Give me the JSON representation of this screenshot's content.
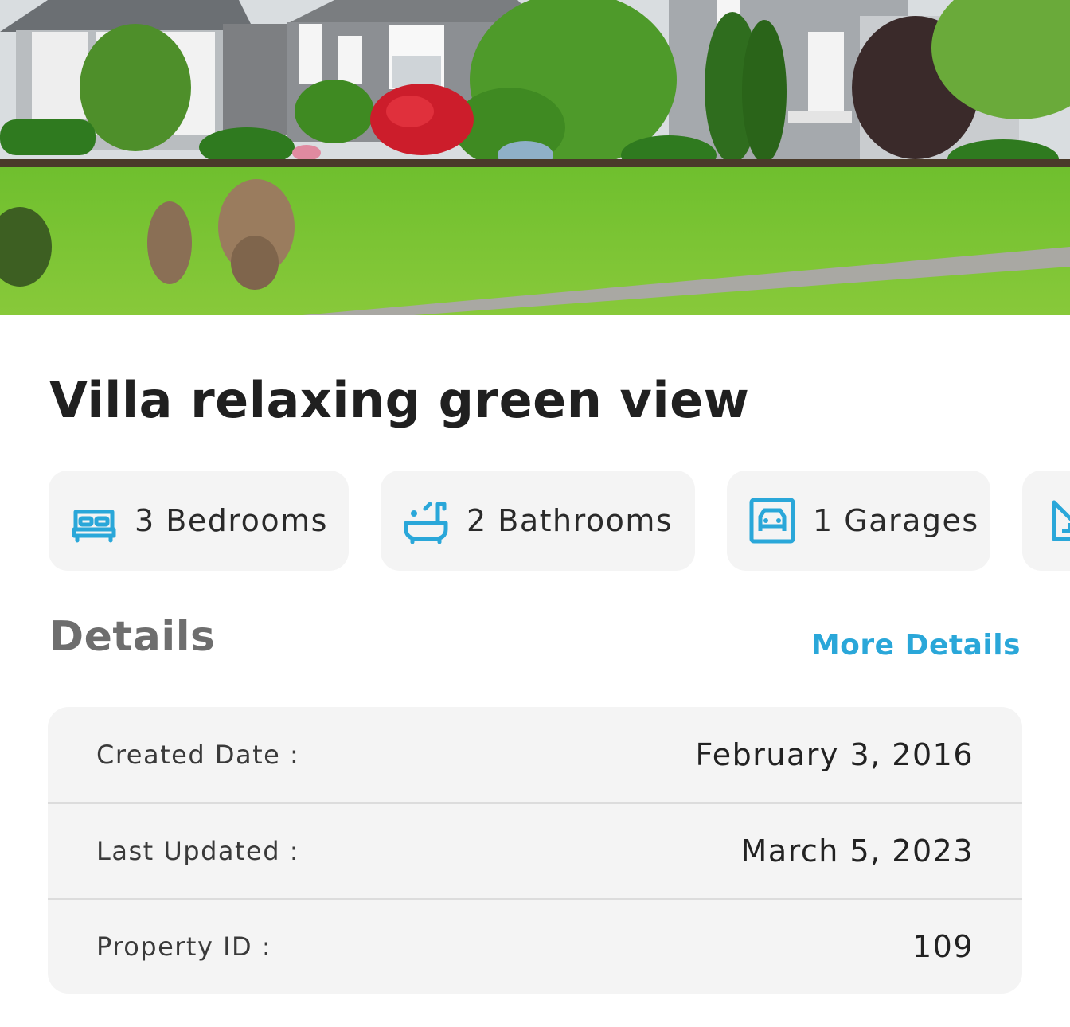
{
  "hero": {
    "image_description": "villa-front-yard-photo"
  },
  "title": "Villa relaxing green view",
  "features": [
    {
      "icon": "bed-icon",
      "label": "3 Bedrooms"
    },
    {
      "icon": "bathtub-icon",
      "label": "2 Bathrooms"
    },
    {
      "icon": "garage-icon",
      "label": "1 Garages"
    },
    {
      "icon": "area-icon",
      "label": ""
    }
  ],
  "details": {
    "heading": "Details",
    "more_link": "More Details",
    "rows": [
      {
        "key": "Created Date :",
        "value": "February 3, 2016"
      },
      {
        "key": "Last Updated :",
        "value": "March 5, 2023"
      },
      {
        "key": "Property ID :",
        "value": "109"
      }
    ]
  },
  "colors": {
    "accent": "#2aa7d9",
    "card_bg": "#f4f4f4",
    "title": "#202020",
    "muted": "#6e6e6e"
  }
}
